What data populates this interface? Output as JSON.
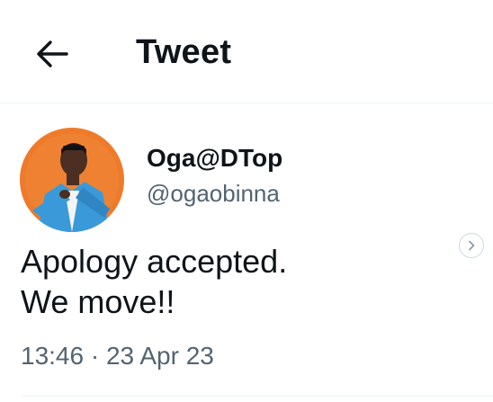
{
  "header": {
    "back_icon": "arrow-left-icon",
    "title": "Tweet"
  },
  "tweet": {
    "author": {
      "display_name": "Oga@DTop",
      "handle": "@ogaobinna",
      "avatar_bg": "#ef7a2a"
    },
    "text_lines": [
      "Apology accepted.",
      "We move!!"
    ],
    "time": "13:46",
    "separator": "·",
    "date": "23 Apr 23",
    "more_icon": "chevron-right-circle-icon"
  }
}
